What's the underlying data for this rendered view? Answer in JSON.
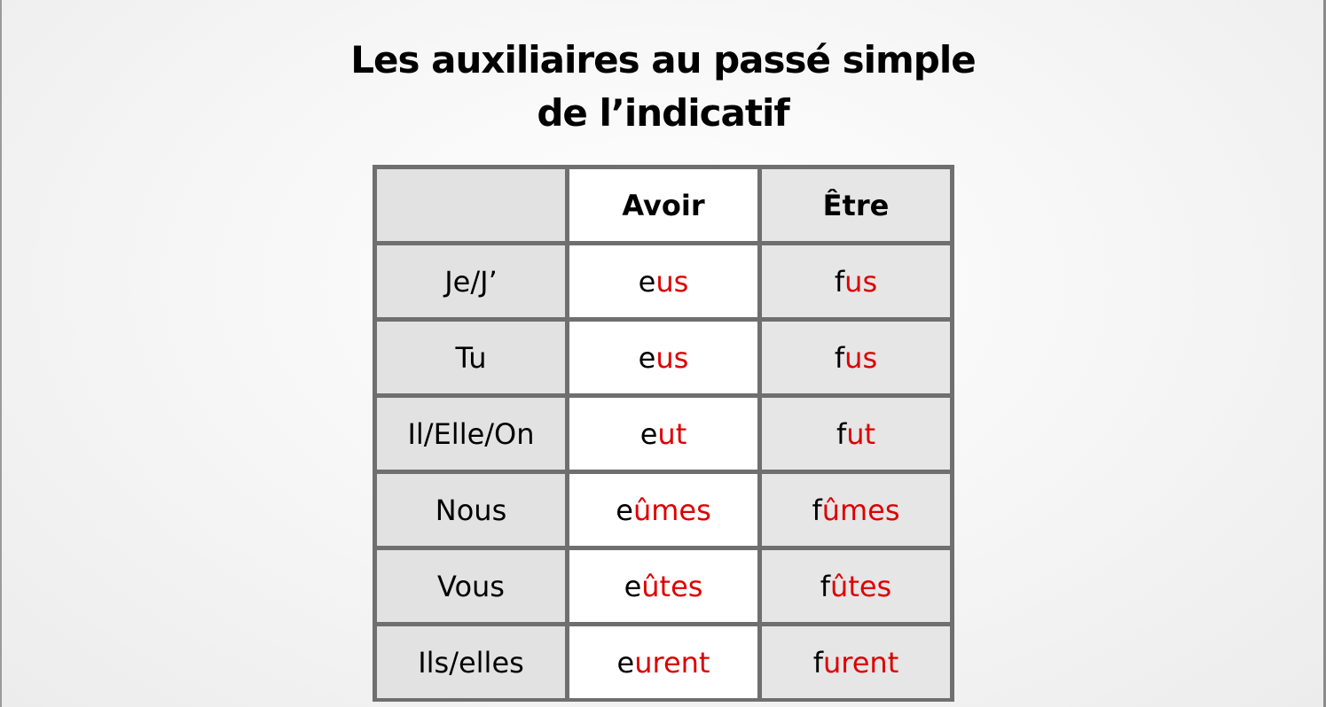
{
  "title": {
    "line1": "Les auxiliaires au passé simple",
    "line2": "de l’indicatif"
  },
  "table": {
    "headers": [
      "",
      "Avoir",
      "Être"
    ],
    "rows": [
      {
        "pronoun": "Je/J’",
        "avoir_stem": "e",
        "avoir_end": "us",
        "etre_stem": "f",
        "etre_end": "us"
      },
      {
        "pronoun": "Tu",
        "avoir_stem": "e",
        "avoir_end": "us",
        "etre_stem": "f",
        "etre_end": "us"
      },
      {
        "pronoun": "Il/Elle/On",
        "avoir_stem": "e",
        "avoir_end": "ut",
        "etre_stem": "f",
        "etre_end": "ut"
      },
      {
        "pronoun": "Nous",
        "avoir_stem": "e",
        "avoir_end": "ûmes",
        "etre_stem": "f",
        "etre_end": "ûmes"
      },
      {
        "pronoun": "Vous",
        "avoir_stem": "e",
        "avoir_end": "ûtes",
        "etre_stem": "f",
        "etre_end": "ûtes"
      },
      {
        "pronoun": "Ils/elles",
        "avoir_stem": "e",
        "avoir_end": "urent",
        "etre_stem": "f",
        "etre_end": "urent"
      }
    ]
  },
  "colors": {
    "ending": "#dd0000",
    "stem": "#000000",
    "table_border": "#6f6f6f"
  }
}
